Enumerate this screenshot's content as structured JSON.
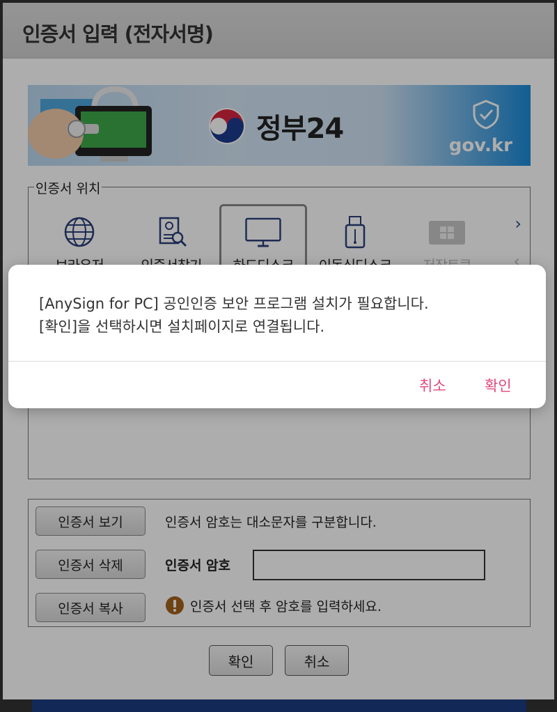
{
  "window": {
    "title": "인증서 입력 (전자서명)"
  },
  "banner": {
    "logo_text": "정부24",
    "domain": "gov.kr"
  },
  "location": {
    "legend": "인증서 위치",
    "items": [
      {
        "label": "브라우저",
        "icon": "globe-icon"
      },
      {
        "label": "인증서찾기",
        "icon": "certificate-search-icon"
      },
      {
        "label": "하드디스크",
        "icon": "monitor-icon",
        "selected": true
      },
      {
        "label": "이동식디스크",
        "icon": "usb-icon"
      },
      {
        "label": "저장토큰",
        "icon": "smartcard-icon",
        "disabled": true
      }
    ]
  },
  "controls": {
    "view_button": "인증서 보기",
    "delete_button": "인증서 삭제",
    "copy_button": "인증서 복사",
    "case_hint": "인증서 암호는 대소문자를 구분합니다.",
    "password_label": "인증서 암호",
    "password_value": "",
    "notice": "인증서 선택 후 암호를 입력하세요."
  },
  "footer": {
    "confirm": "확인",
    "cancel": "취소"
  },
  "alert": {
    "line1": "[AnySign for PC] 공인인증 보안 프로그램 설치가 필요합니다.",
    "line2": "[확인]을 선택하시면 설치페이지로 연결됩니다.",
    "cancel": "취소",
    "confirm": "확인"
  },
  "colors": {
    "alert_button": "#e0487e",
    "banner_blue": "#1c8ad8"
  }
}
